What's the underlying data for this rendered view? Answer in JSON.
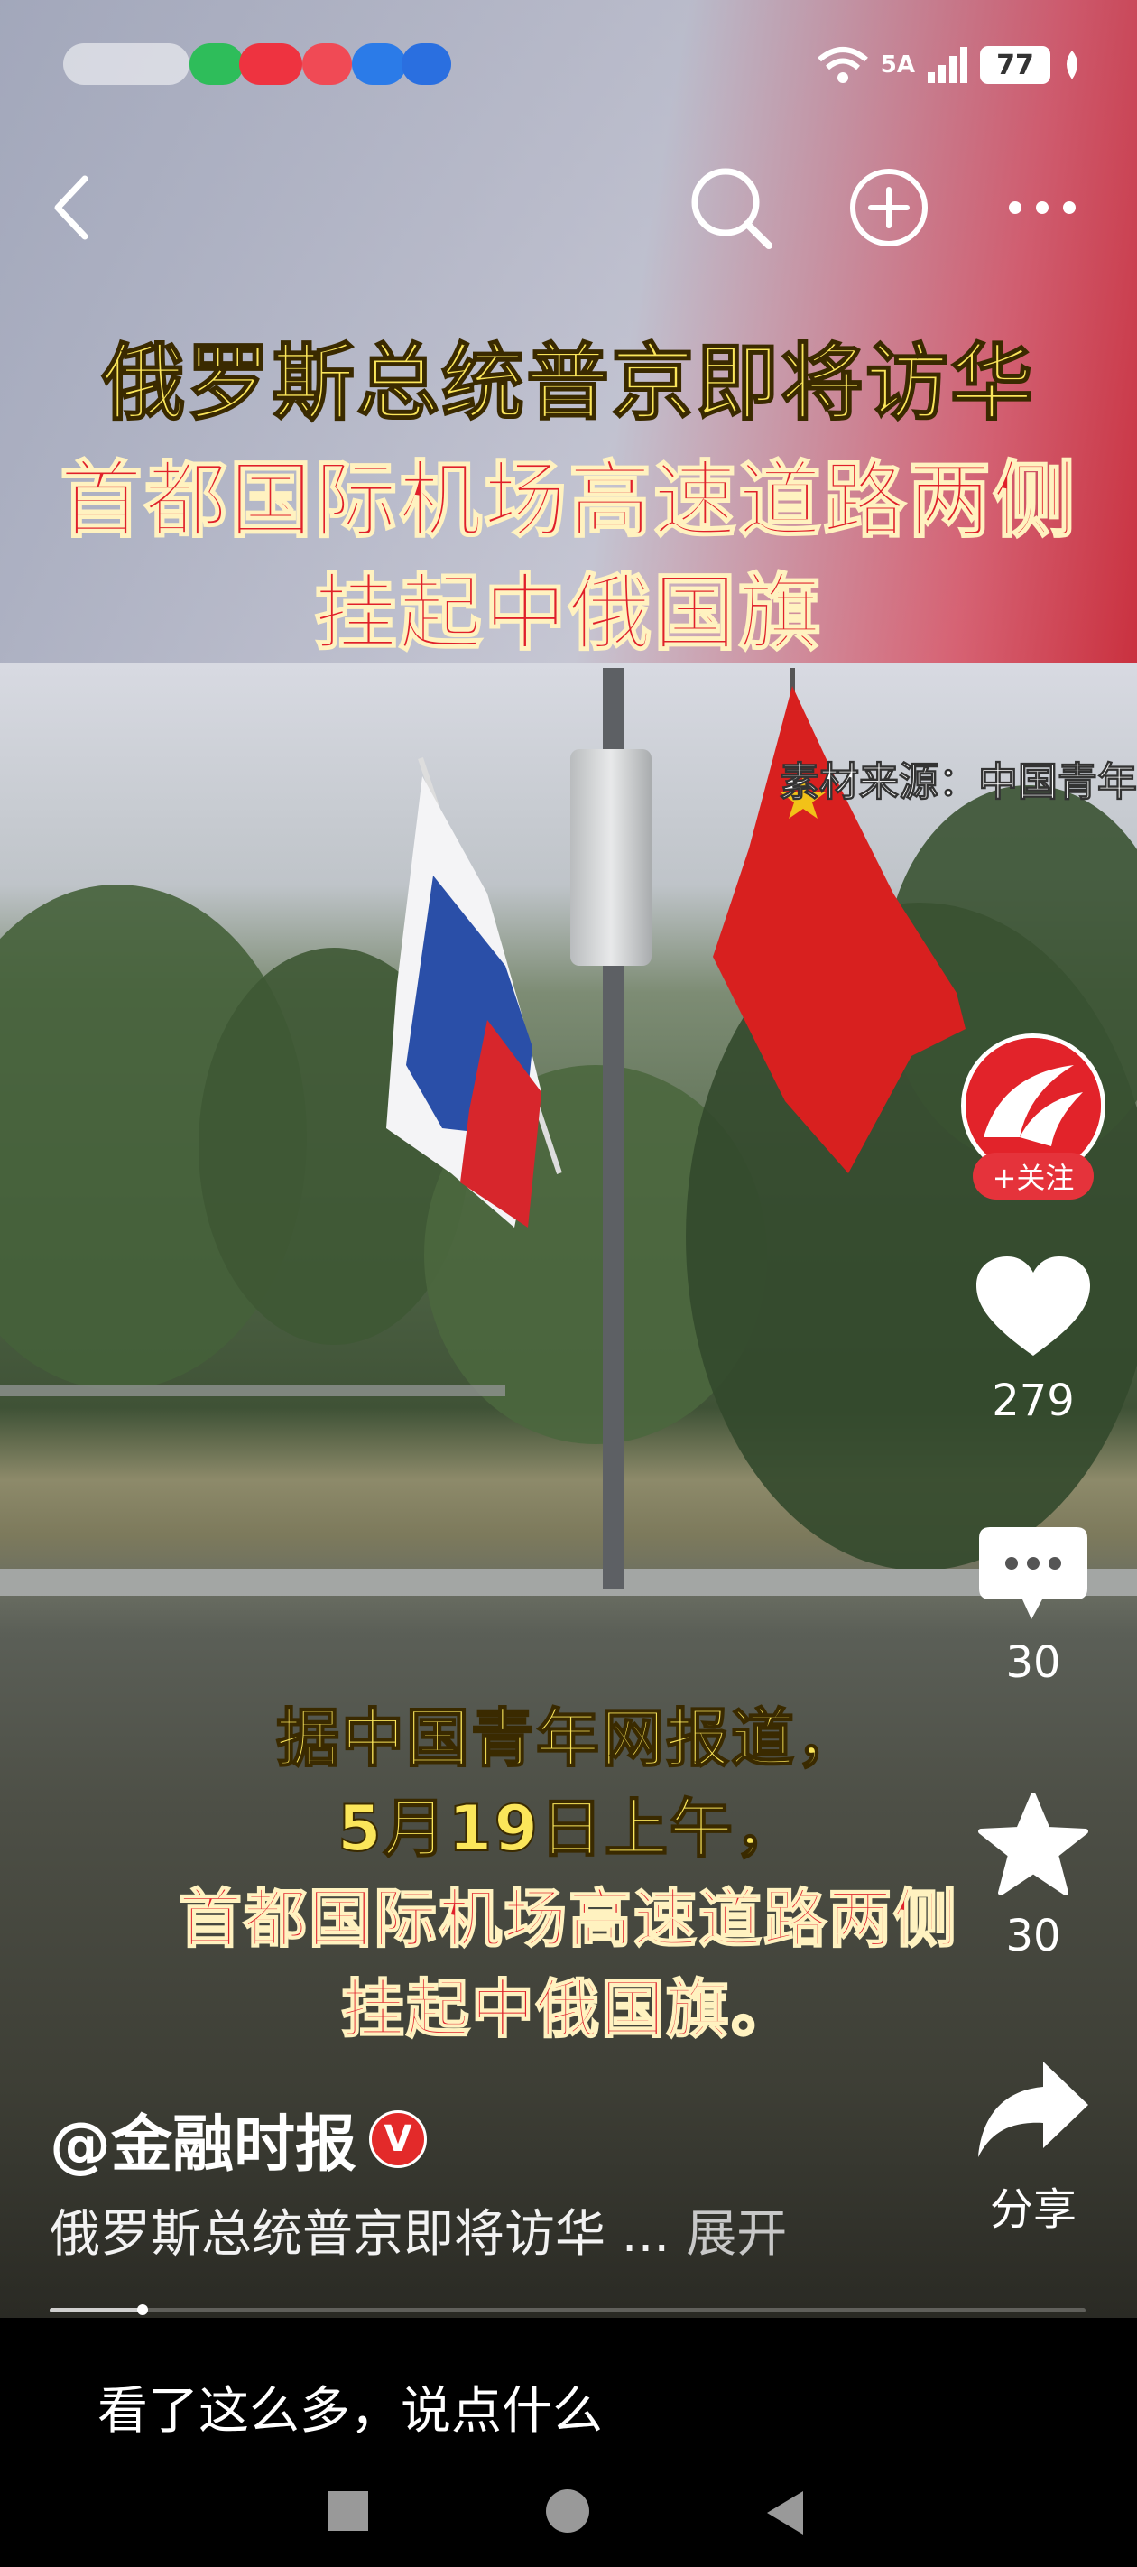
{
  "status_bar": {
    "network": "5A",
    "battery": "77"
  },
  "nav": {
    "back_icon": "chevron-left-icon",
    "search_icon": "search-icon",
    "add_icon": "plus-circle-icon",
    "more_icon": "more-dots-icon"
  },
  "video": {
    "headline_line1": "俄罗斯总统普京即将访华",
    "headline_line2": "首都国际机场高速道路两侧",
    "headline_line3": "挂起中俄国旗",
    "source": "素材来源：中国青年",
    "subtitle_line1": "据中国青年网报道，",
    "subtitle_line2": "5月19日上午，",
    "subtitle_line3": "首都国际机场高速道路两侧",
    "subtitle_line4": "挂起中俄国旗。"
  },
  "actions": {
    "follow_label": "+关注",
    "likes": "279",
    "comments": "30",
    "favorites": "30",
    "share_label": "分享"
  },
  "post": {
    "author": "@金融时报",
    "verified": "V",
    "description": "俄罗斯总统普京即将访华 ...",
    "expand": "展开",
    "progress": 0.09
  },
  "comment_bar": {
    "placeholder": "看了这么多，说点什么"
  },
  "colors": {
    "accent_red": "#e5333b",
    "caption_yellow": "#fbe65a",
    "caption_red": "#e0202a"
  }
}
